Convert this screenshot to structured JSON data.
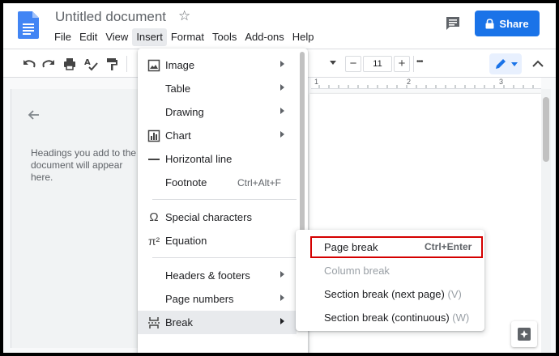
{
  "app": {
    "doc_title": "Untitled document",
    "menubar": [
      "File",
      "Edit",
      "View",
      "Insert",
      "Format",
      "Tools",
      "Add-ons",
      "Help"
    ],
    "active_menu": "Insert",
    "share_label": "Share"
  },
  "toolbar": {
    "font_size": "11",
    "minus": "−",
    "plus": "+",
    "more": "•••"
  },
  "ruler": {
    "ticks": [
      "1",
      "2",
      "3"
    ]
  },
  "outline": {
    "empty_text": "Headings you add to the document will appear here."
  },
  "insert_menu": {
    "items": [
      {
        "label": "Image",
        "icon": "image-icon",
        "submenu": true
      },
      {
        "label": "Table",
        "icon": "",
        "submenu": true
      },
      {
        "label": "Drawing",
        "icon": "",
        "submenu": true
      },
      {
        "label": "Chart",
        "icon": "chart-icon",
        "submenu": true
      },
      {
        "label": "Horizontal line",
        "icon": "horizontal-line-icon",
        "submenu": false
      },
      {
        "label": "Footnote",
        "icon": "",
        "shortcut": "Ctrl+Alt+F"
      },
      {
        "label": "Special characters",
        "icon": "omega-icon",
        "submenu": false
      },
      {
        "label": "Equation",
        "icon": "pi-icon",
        "submenu": false
      },
      {
        "label": "Headers & footers",
        "icon": "",
        "submenu": true
      },
      {
        "label": "Page numbers",
        "icon": "",
        "submenu": true
      },
      {
        "label": "Break",
        "icon": "break-icon",
        "submenu": true
      }
    ]
  },
  "break_menu": {
    "page_break": {
      "label": "Page break",
      "shortcut": "Ctrl+Enter"
    },
    "column_break": {
      "label": "Column break"
    },
    "section_next": {
      "label": "Section break (next page)",
      "key": "(V)"
    },
    "section_continuous": {
      "label": "Section break (continuous)",
      "key": "(W)"
    }
  },
  "colors": {
    "accent": "#1a73e8",
    "highlight": "#d40000"
  }
}
